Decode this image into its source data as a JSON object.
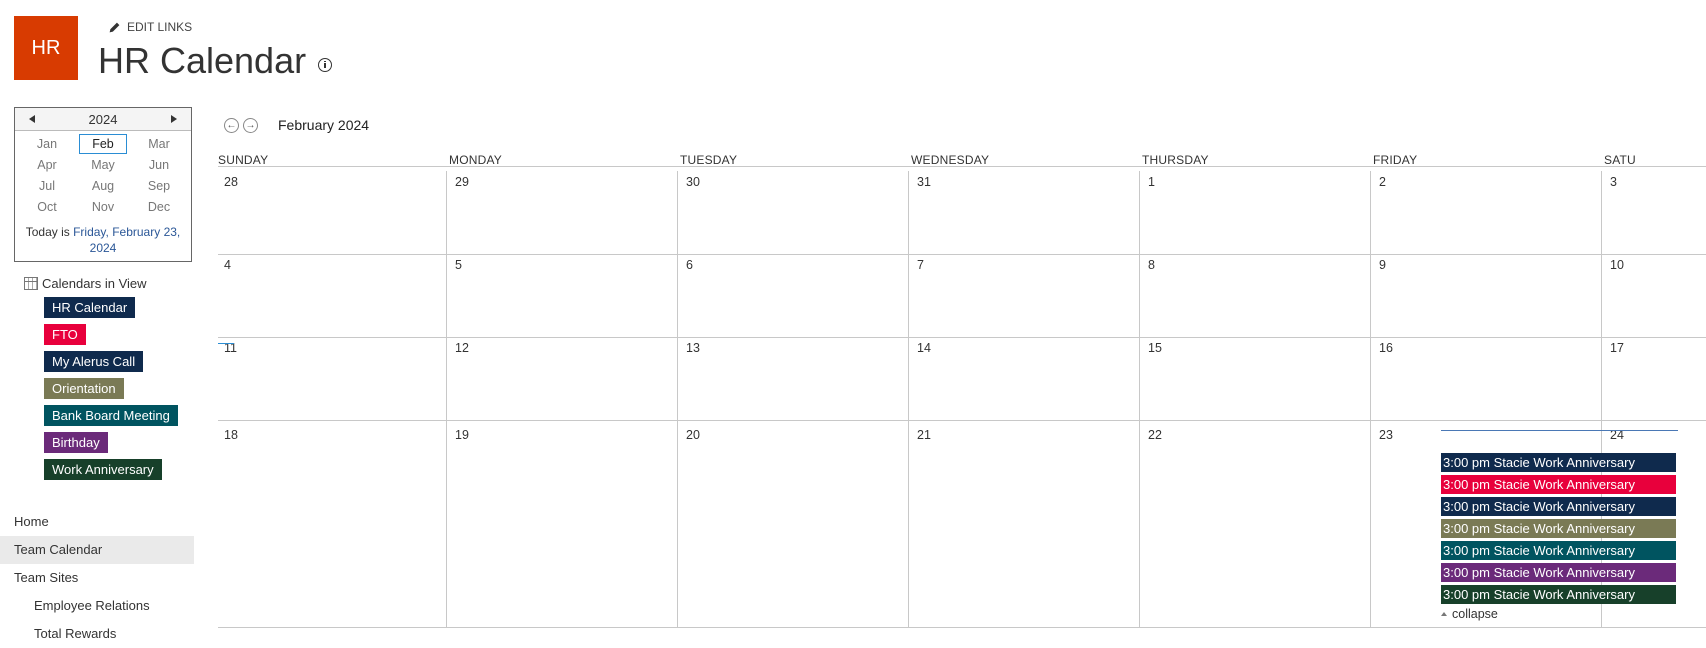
{
  "logo": {
    "text": "HR",
    "color": "#d83b01"
  },
  "edit_links": {
    "label": "EDIT LINKS",
    "icon": "pencil-icon"
  },
  "page_title": "HR Calendar",
  "picker": {
    "year": "2024",
    "months": [
      "Jan",
      "Feb",
      "Mar",
      "Apr",
      "May",
      "Jun",
      "Jul",
      "Aug",
      "Sep",
      "Oct",
      "Nov",
      "Dec"
    ],
    "selected": "Feb",
    "today_prefix": "Today is ",
    "today_link": "Friday, February 23, 2024"
  },
  "calendars_in_view": {
    "label": "Calendars in View",
    "items": [
      {
        "label": "HR Calendar",
        "color": "#0f2a4d"
      },
      {
        "label": "FTO",
        "color": "#e8003c"
      },
      {
        "label": "My Alerus Call",
        "color": "#0f2a4d"
      },
      {
        "label": "Orientation",
        "color": "#7a7a55"
      },
      {
        "label": "Bank Board Meeting",
        "color": "#005460"
      },
      {
        "label": "Birthday",
        "color": "#6b2a7a"
      },
      {
        "label": "Work Anniversary",
        "color": "#17402a"
      }
    ]
  },
  "nav": {
    "items": [
      {
        "label": "Home"
      },
      {
        "label": "Team Calendar",
        "active": true
      },
      {
        "label": "Team Sites"
      },
      {
        "label": "Employee Relations",
        "sub": true
      },
      {
        "label": "Total Rewards",
        "sub": true
      }
    ]
  },
  "calendar": {
    "month_title": "February 2024",
    "weekdays": [
      "SUNDAY",
      "MONDAY",
      "TUESDAY",
      "WEDNESDAY",
      "THURSDAY",
      "FRIDAY",
      "SATU"
    ],
    "weeks": [
      [
        "28",
        "29",
        "30",
        "31",
        "1",
        "2",
        "3"
      ],
      [
        "4",
        "5",
        "6",
        "7",
        "8",
        "9",
        "10"
      ],
      [
        "11",
        "12",
        "13",
        "14",
        "15",
        "16",
        "17"
      ],
      [
        "18",
        "19",
        "20",
        "21",
        "22",
        "23",
        "24"
      ]
    ],
    "events": [
      {
        "label": "3:00 pm Stacie Work Anniversary",
        "color": "#0f2a4d"
      },
      {
        "label": "3:00 pm Stacie Work Anniversary",
        "color": "#e8003c"
      },
      {
        "label": "3:00 pm Stacie Work Anniversary",
        "color": "#0f2a4d"
      },
      {
        "label": "3:00 pm Stacie Work Anniversary",
        "color": "#7a7a55"
      },
      {
        "label": "3:00 pm Stacie Work Anniversary",
        "color": "#005460"
      },
      {
        "label": "3:00 pm Stacie Work Anniversary",
        "color": "#6b2a7a"
      },
      {
        "label": "3:00 pm Stacie Work Anniversary",
        "color": "#17402a"
      }
    ],
    "collapse_label": "collapse"
  }
}
